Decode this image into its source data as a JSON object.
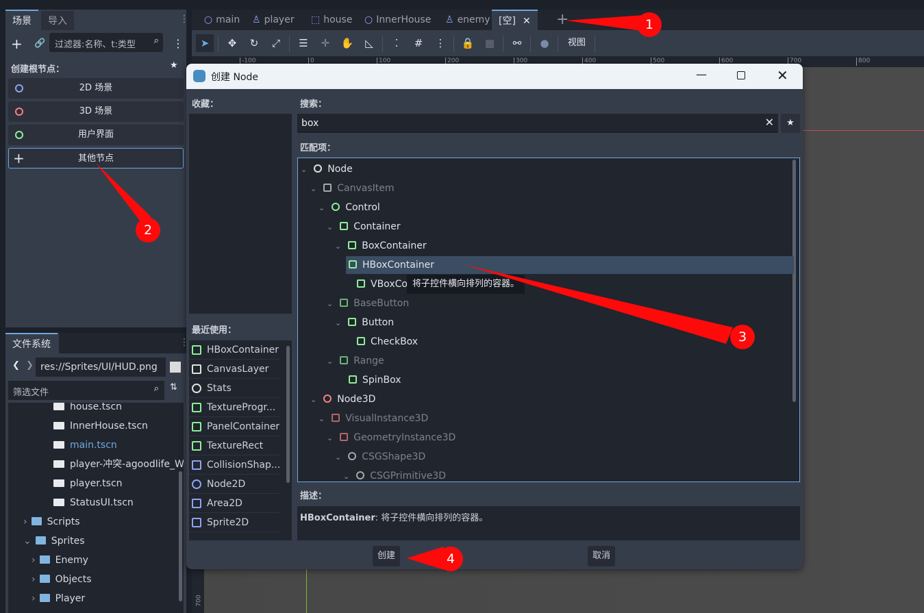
{
  "scene_dock": {
    "tabs": [
      "场景",
      "导入"
    ],
    "filter_placeholder": "过滤器:名称、t:类型",
    "create_root_label": "创建根节点：",
    "root_buttons": [
      {
        "label": "2D 场景",
        "color": "#8da5f3"
      },
      {
        "label": "3D 场景",
        "color": "#fc7f7f"
      },
      {
        "label": "用户界面",
        "color": "#8eef97"
      },
      {
        "label": "其他节点",
        "color": "#ffffff"
      }
    ]
  },
  "filesystem": {
    "tab": "文件系统",
    "path": "res://Sprites/UI/HUD.png",
    "filter_placeholder": "筛选文件",
    "items": [
      {
        "name": "house.tscn",
        "type": "scene",
        "indent": 2
      },
      {
        "name": "InnerHouse.tscn",
        "type": "scene",
        "indent": 2
      },
      {
        "name": "main.tscn",
        "type": "scene",
        "indent": 2,
        "highlight": true
      },
      {
        "name": "player-冲突-agoodlife_Wi...",
        "type": "scene",
        "indent": 2
      },
      {
        "name": "player.tscn",
        "type": "scene",
        "indent": 2
      },
      {
        "name": "StatusUI.tscn",
        "type": "scene",
        "indent": 2
      },
      {
        "name": "Scripts",
        "type": "folder",
        "indent": 1,
        "arrow": "›"
      },
      {
        "name": "Sprites",
        "type": "folder",
        "indent": 1,
        "arrow": "⌄"
      },
      {
        "name": "Enemy",
        "type": "folder",
        "indent": 2,
        "arrow": "›"
      },
      {
        "name": "Objects",
        "type": "folder",
        "indent": 2,
        "arrow": "›"
      },
      {
        "name": "Player",
        "type": "folder",
        "indent": 2,
        "arrow": "›"
      }
    ]
  },
  "editor_tabs": [
    {
      "label": "main",
      "icon": "circle"
    },
    {
      "label": "player",
      "icon": "character"
    },
    {
      "label": "house",
      "icon": "dashed-square"
    },
    {
      "label": "InnerHouse",
      "icon": "circle"
    },
    {
      "label": "enemy",
      "icon": "character"
    },
    {
      "label": "[空]",
      "active": true
    }
  ],
  "toolbar": {
    "view_label": "视图"
  },
  "ruler": {
    "top": [
      "-100",
      "0",
      "100",
      "200",
      "300",
      "400",
      "500",
      "600",
      "700",
      "800"
    ],
    "left": [
      "700"
    ]
  },
  "dialog": {
    "title": "创建 Node",
    "favorites_label": "收藏：",
    "recent_label": "最近使用：",
    "search_label": "搜索：",
    "search_value": "box",
    "matches_label": "匹配项：",
    "description_label": "描述：",
    "description_name": "HBoxContainer",
    "description_text": ": 将子控件横向排列的容器。",
    "tooltip": "将子控件横向排列的容器。",
    "create_button": "创建",
    "cancel_button": "取消",
    "recent": [
      {
        "label": "HBoxContainer",
        "color": "#8eef97"
      },
      {
        "label": "CanvasLayer",
        "color": "#e0e0e0"
      },
      {
        "label": "Stats",
        "color": "#e0e0e0"
      },
      {
        "label": "TextureProgr...",
        "color": "#8eef97"
      },
      {
        "label": "PanelContainer",
        "color": "#8eef97"
      },
      {
        "label": "TextureRect",
        "color": "#8eef97"
      },
      {
        "label": "CollisionShap...",
        "color": "#8da5f3"
      },
      {
        "label": "Node2D",
        "color": "#8da5f3"
      },
      {
        "label": "Area2D",
        "color": "#8da5f3"
      },
      {
        "label": "Sprite2D",
        "color": "#8da5f3"
      }
    ],
    "tree": [
      {
        "label": "Node",
        "level": 0,
        "color": "#e0e0e0"
      },
      {
        "label": "CanvasItem",
        "level": 1,
        "color": "#e0e0e0",
        "dim": true
      },
      {
        "label": "Control",
        "level": 2,
        "color": "#8eef97"
      },
      {
        "label": "Container",
        "level": 3,
        "color": "#8eef97"
      },
      {
        "label": "BoxContainer",
        "level": 4,
        "color": "#8eef97"
      },
      {
        "label": "HBoxContainer",
        "level": 5,
        "color": "#8eef97",
        "selected": true
      },
      {
        "label": "VBoxContainer",
        "level": 5,
        "color": "#8eef97"
      },
      {
        "label": "BaseButton",
        "level": 3,
        "color": "#8eef97",
        "dim": true
      },
      {
        "label": "Button",
        "level": 4,
        "color": "#8eef97"
      },
      {
        "label": "CheckBox",
        "level": 5,
        "color": "#8eef97"
      },
      {
        "label": "Range",
        "level": 3,
        "color": "#8eef97",
        "dim": true
      },
      {
        "label": "SpinBox",
        "level": 4,
        "color": "#8eef97"
      },
      {
        "label": "Node3D",
        "level": 1,
        "color": "#fc7f7f"
      },
      {
        "label": "VisualInstance3D",
        "level": 2,
        "color": "#fc7f7f",
        "dim": true
      },
      {
        "label": "GeometryInstance3D",
        "level": 3,
        "color": "#fc7f7f",
        "dim": true
      },
      {
        "label": "CSGShape3D",
        "level": 4,
        "color": "#e0e0e0",
        "dim": true
      },
      {
        "label": "CSGPrimitive3D",
        "level": 5,
        "color": "#e0e0e0",
        "dim": true
      }
    ]
  },
  "annotations": [
    "1",
    "2",
    "3",
    "4"
  ],
  "colors": {
    "accent": "#6ea8e0",
    "panel": "#363d4a",
    "annotation": "#ff0a0a"
  }
}
